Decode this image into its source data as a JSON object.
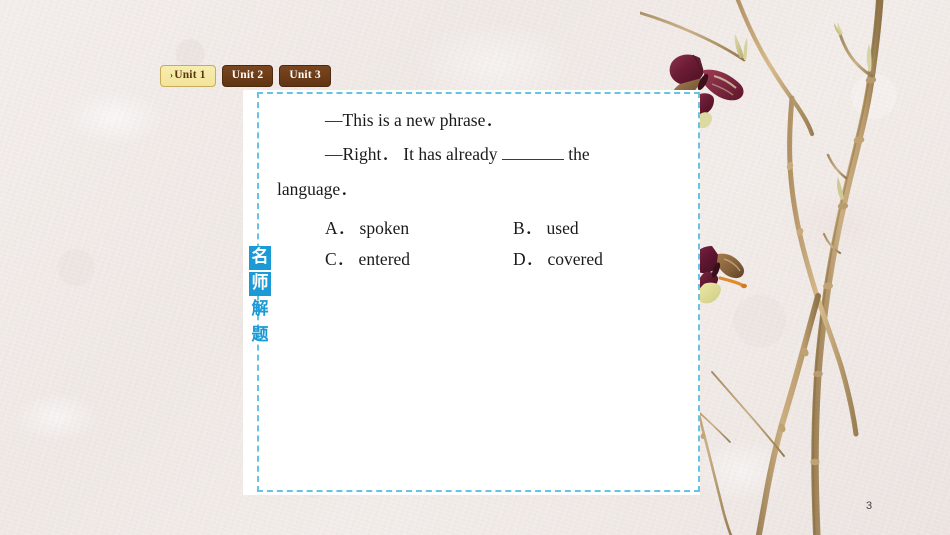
{
  "slide": {
    "page_number": "3",
    "background_color": "#efe9e6",
    "panel_color": "#ffffff",
    "dashed_border_color": "#66c3e3"
  },
  "tabs": [
    {
      "label": "Unit 1",
      "arrow": "›",
      "active": true,
      "bg": "#f5e8a2",
      "fg": "#5a3410"
    },
    {
      "label": "Unit 2",
      "arrow": "",
      "active": false,
      "bg": "#6b3a16",
      "fg": "#ffffff"
    },
    {
      "label": "Unit 3",
      "arrow": "",
      "active": false,
      "bg": "#6b3a16",
      "fg": "#ffffff"
    }
  ],
  "side_label": {
    "accent_color": "#1c9ad6",
    "chars": [
      {
        "text": "名",
        "boxed": true
      },
      {
        "text": "师",
        "boxed": true
      },
      {
        "text": "解",
        "boxed": false
      },
      {
        "text": "题",
        "boxed": false
      }
    ]
  },
  "question": {
    "line1": "—This is a new phrase．",
    "line2_before": "—Right． It has already",
    "line2_after": "the",
    "line3": "language．",
    "options": [
      {
        "label": "A． spoken",
        "key": "A",
        "text": "spoken"
      },
      {
        "label": "B． used",
        "key": "B",
        "text": "used"
      },
      {
        "label": "C． entered",
        "key": "C",
        "text": "entered"
      },
      {
        "label": "D． covered",
        "key": "D",
        "text": "covered"
      }
    ]
  },
  "artwork": {
    "description": "dried branches with buds and pressed butterflies",
    "branch_color": "#c0a276",
    "bud_color": "#7a2140",
    "butterfly_wing_color": "#7c1f3d",
    "butterfly_lower_color": "#e8e9a6"
  }
}
